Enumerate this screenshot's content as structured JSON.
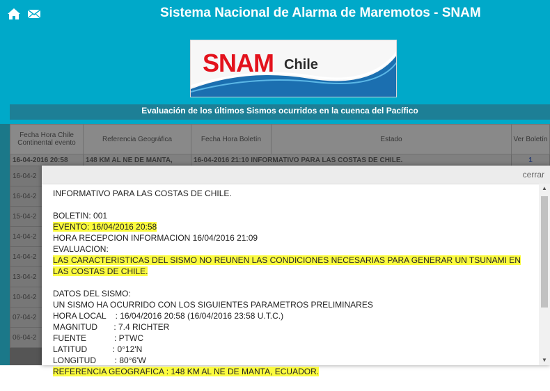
{
  "header": {
    "title": "Sistema Nacional de Alarma de Maremotos - SNAM"
  },
  "icons": {
    "home": "home-icon",
    "mail": "mail-icon"
  },
  "logo": {
    "snam": "SNAM",
    "chile": "Chile"
  },
  "subtitle": "Evaluación de los últimos Sismos ocurridos en la cuenca del Pacífico",
  "table": {
    "headers": [
      "Fecha Hora Chile Continental evento",
      "Referencia Geográfica",
      "Fecha Hora Boletín",
      "Estado",
      "Ver Boletín"
    ],
    "first_row": [
      "16-04-2016 20:58",
      "148 KM AL NE DE MANTA,",
      "16-04-2016 21:10",
      "INFORMATIVO PARA LAS COSTAS DE CHILE.",
      "1"
    ],
    "rows": [
      "16-04-2",
      "16-04-2",
      "15-04-2",
      "14-04-2",
      "14-04-2",
      "13-04-2",
      "10-04-2",
      "07-04-2",
      "06-04-2"
    ]
  },
  "modal": {
    "close_label": "cerrar",
    "lines": [
      {
        "text": "INFORMATIVO PARA LAS COSTAS DE CHILE.",
        "hl": false
      },
      {
        "text": "",
        "hl": false
      },
      {
        "text": "BOLETIN: 001",
        "hl": false
      },
      {
        "text": "EVENTO: 16/04/2016 20:58",
        "hl": true
      },
      {
        "text": "HORA RECEPCION INFORMACION 16/04/2016 21:09",
        "hl": false
      },
      {
        "text": "EVALUACION:",
        "hl": false
      },
      {
        "text": "LAS CARACTERISTICAS DEL SISMO NO REUNEN LAS CONDICIONES NECESARIAS PARA GENERAR UN TSUNAMI EN LAS COSTAS DE CHILE.",
        "hl": true,
        "wrap": true
      },
      {
        "text": "",
        "hl": false
      },
      {
        "text": "DATOS DEL SISMO:",
        "hl": false
      },
      {
        "text": "UN SISMO HA OCURRIDO CON LOS SIGUIENTES PARAMETROS PRELIMINARES",
        "hl": false
      },
      {
        "text": "HORA LOCAL    : 16/04/2016 20:58 (16/04/2016 23:58 U.T.C.)",
        "hl": false
      },
      {
        "text": "MAGNITUD       : 7.4 RICHTER",
        "hl": false
      },
      {
        "text": "FUENTE            : PTWC",
        "hl": false
      },
      {
        "text": "LATITUD           : 0°12'N",
        "hl": false
      },
      {
        "text": "LONGITUD        : 80°6'W",
        "hl": false
      }
    ],
    "below_line": "REFERENCIA GEOGRAFICA : 148 KM AL NE DE MANTA, ECUADOR."
  }
}
